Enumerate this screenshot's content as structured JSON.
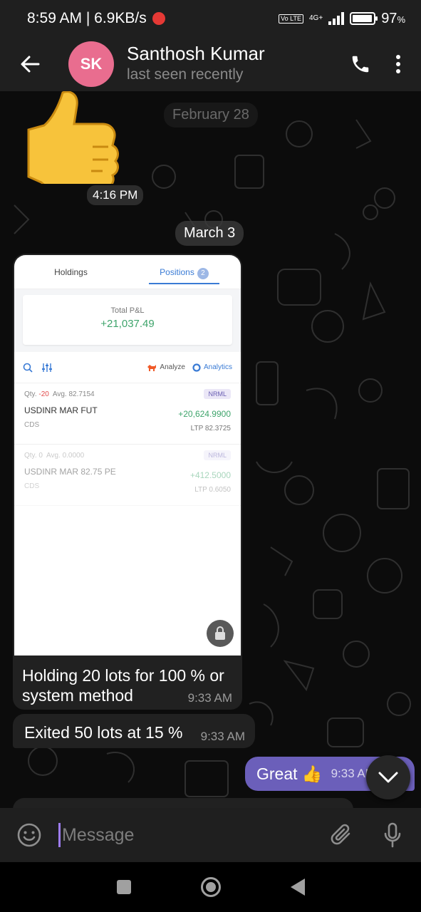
{
  "status_bar": {
    "time_speed": "8:59 AM | 6.9KB/s",
    "volte": "Vo LTE",
    "network": "4G+",
    "battery": "97",
    "battery_unit": "%",
    "battery_level": 0.97
  },
  "header": {
    "avatar_initials": "SK",
    "avatar_color": "#e96d8f",
    "name": "Santhosh Kumar",
    "status": "last seen recently",
    "icons": [
      "back-arrow-icon",
      "phone-icon",
      "more-vertical-icon"
    ]
  },
  "chat": {
    "date_top": "February 28",
    "sticker_emoji": "👍",
    "sticker_time": "4:16 PM",
    "date_march": "March 3",
    "screenshot": {
      "tab_holdings": "Holdings",
      "tab_positions": "Positions",
      "positions_count": "2",
      "pnl_label": "Total P&L",
      "pnl_value": "+21,037.49",
      "analyze": "Analyze",
      "analytics": "Analytics",
      "positions": [
        {
          "qty_label": "Qty.",
          "qty": "-20",
          "avg_label": "Avg.",
          "avg": "82.7154",
          "product": "NRML",
          "instrument": "USDINR MAR FUT",
          "pnl": "+20,624.9900",
          "exchange": "CDS",
          "ltp_label": "LTP",
          "ltp": "82.3725"
        },
        {
          "qty_label": "Qty.",
          "qty": "0",
          "avg_label": "Avg.",
          "avg": "0.0000",
          "product": "NRML",
          "instrument": "USDINR MAR 82.75 PE",
          "pnl": "+412.5000",
          "exchange": "CDS",
          "ltp_label": "LTP",
          "ltp": "0.6050"
        }
      ]
    },
    "messages": [
      {
        "text": "Holding 20 lots for 100 % or system method",
        "line1": "Holding 20 lots for 100 % or",
        "line2": "system method",
        "time": "9:33 AM",
        "direction": "incoming"
      },
      {
        "text": "Exited 50 lots at 15 %",
        "time": "9:33 AM",
        "direction": "incoming"
      },
      {
        "text": "Great 👍",
        "time": "9:33 AM",
        "direction": "outgoing"
      }
    ]
  },
  "composer": {
    "placeholder": "Message",
    "value": ""
  },
  "colors": {
    "accent": "#6b5fba",
    "profit_green": "#3ea46b",
    "loss_red": "#e24b4b",
    "link_blue": "#3a7bd5"
  }
}
